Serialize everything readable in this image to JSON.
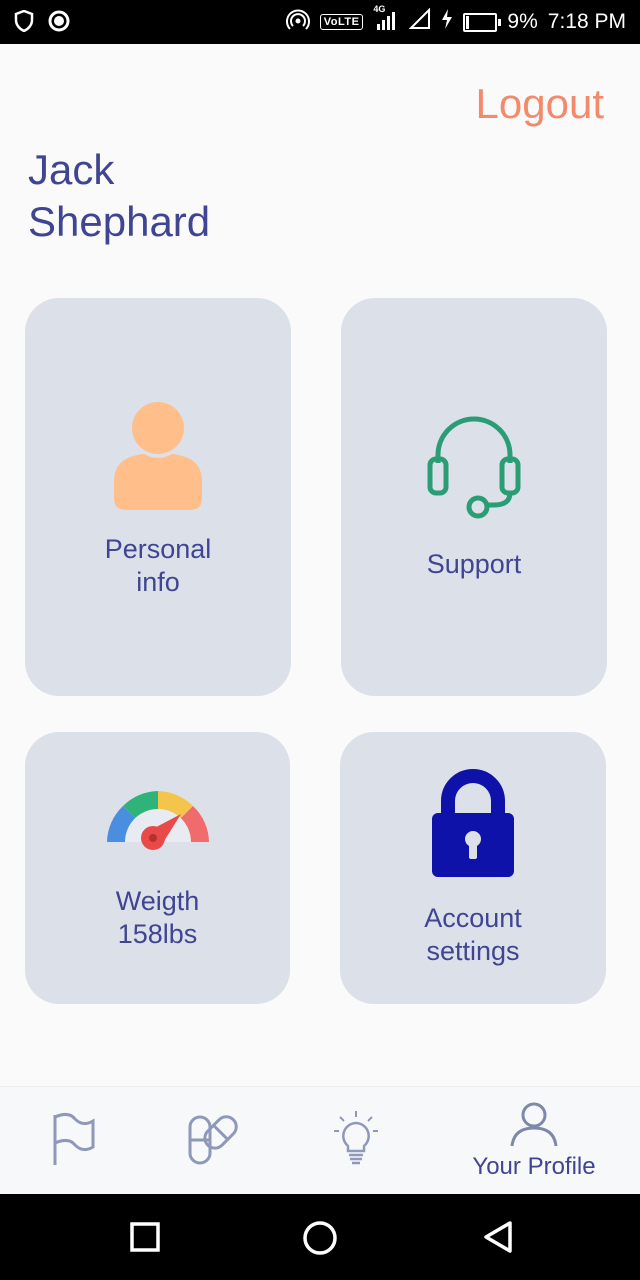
{
  "status_bar": {
    "battery": "9%",
    "time": "7:18 PM",
    "network_badge": "VoLTE",
    "network_type": "4G"
  },
  "header": {
    "logout_label": "Logout",
    "user_name": "Jack\nShephard"
  },
  "cards": [
    {
      "label": "Personal\ninfo",
      "icon": "person-icon"
    },
    {
      "label": "Support",
      "icon": "headset-icon"
    },
    {
      "label": "Weigth\n158lbs",
      "icon": "gauge-icon"
    },
    {
      "label": "Account\nsettings",
      "icon": "lock-icon"
    }
  ],
  "bottom_nav": {
    "items": [
      {
        "icon": "flag-icon"
      },
      {
        "icon": "pills-icon"
      },
      {
        "icon": "lightbulb-icon"
      },
      {
        "icon": "user-icon",
        "label": "Your Profile"
      }
    ]
  },
  "colors": {
    "accent": "#3f4592",
    "logout": "#f28a6b",
    "card_bg": "#dce0e8",
    "support_green": "#2a9d74",
    "lock_blue": "#0f12a8"
  }
}
